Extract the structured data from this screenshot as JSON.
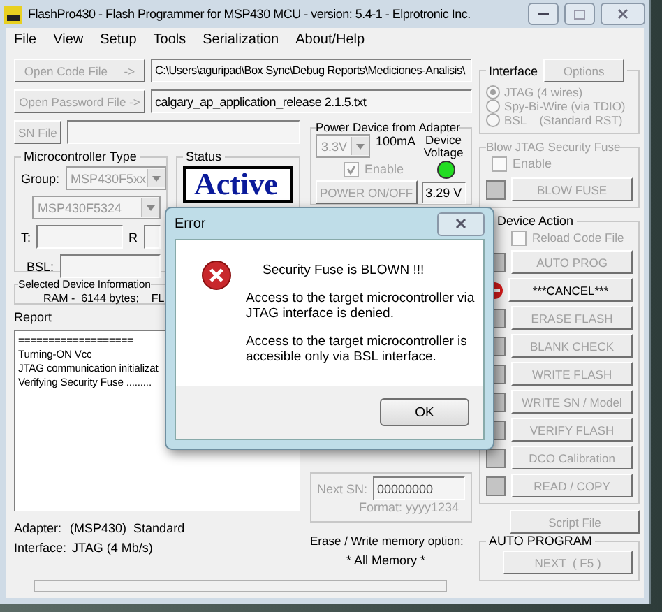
{
  "window": {
    "title": "FlashPro430 - Flash Programmer for MSP430 MCU - version: 5.4-1 - Elprotronic Inc."
  },
  "menu": [
    "File",
    "View",
    "Setup",
    "Tools",
    "Serialization",
    "About/Help"
  ],
  "files": [
    {
      "button": "Open Code File     ->",
      "value": "C:\\Users\\aguripad\\Box Sync\\Debug Reports\\Mediciones-Analisis\\",
      "disabled": true
    },
    {
      "button": "Open Password File ->",
      "value": "calgary_ap_application_release 2.1.5.txt",
      "disabled": true
    }
  ],
  "sn_file": {
    "button": "SN File",
    "disabled": true
  },
  "microcontroller": {
    "title": "Microcontroller Type",
    "group_label": "Group:",
    "group": "MSP430F5xx",
    "device": "MSP430F5324",
    "t_label": "T:",
    "r_label": "R",
    "bsl_label": "BSL:"
  },
  "status": {
    "title": "Status",
    "value": "Active"
  },
  "device_info": {
    "title": "Selected Device Information",
    "text": "RAM -  6144 bytes;    FL"
  },
  "report": {
    "title": "Report",
    "lines": [
      "===================",
      "Turning-ON Vcc",
      "JTAG communication initializat",
      "Verifying Security Fuse ........."
    ]
  },
  "adapter": {
    "label": "Adapter:",
    "value": "(MSP430)  Standard"
  },
  "interface_info": {
    "label": "Interface:",
    "value": "JTAG (4 Mb/s)"
  },
  "progress": {
    "level": 0
  },
  "power": {
    "title": "Power Device from Adapter",
    "voltage": "3.3V",
    "current": "100mA",
    "voltage_label": "Device Voltage",
    "enable": "Enable",
    "enable_checked": true,
    "on": true,
    "button": "POWER ON/OFF",
    "reading": "3.29 V"
  },
  "next_sn": {
    "label": "Next SN:",
    "value": "00000000",
    "format": "Format: yyyy1234"
  },
  "memory_option": {
    "label": "Erase / Write memory option:",
    "value": "* All Memory *"
  },
  "interface": {
    "title": "Interface",
    "options_button": "Options",
    "options": [
      {
        "label": "JTAG (4 wires)",
        "selected": true
      },
      {
        "label": "Spy-Bi-Wire (via TDIO)",
        "selected": false
      },
      {
        "label": "BSL    (Standard RST)",
        "selected": false
      }
    ]
  },
  "fuse": {
    "title": "Blow JTAG Security Fuse",
    "enable": "Enable",
    "enable_checked": false,
    "button": "BLOW FUSE"
  },
  "device_action": {
    "title": "Device Action",
    "reload": "Reload Code File",
    "reload_checked": false,
    "actions": [
      {
        "kind": "square",
        "label": "AUTO PROG",
        "disabled": true
      },
      {
        "kind": "stop",
        "label": "***CANCEL***",
        "disabled": false
      },
      {
        "kind": "square",
        "label": "ERASE FLASH",
        "disabled": true
      },
      {
        "kind": "square",
        "label": "BLANK CHECK",
        "disabled": true
      },
      {
        "kind": "square",
        "label": "WRITE FLASH",
        "disabled": true
      },
      {
        "kind": "square",
        "label": "WRITE SN / Model",
        "disabled": true
      },
      {
        "kind": "square",
        "label": "VERIFY FLASH",
        "disabled": true
      },
      {
        "kind": "square",
        "label": "DCO Calibration",
        "disabled": true
      },
      {
        "kind": "square",
        "label": "READ / COPY",
        "disabled": true
      }
    ]
  },
  "script_file": {
    "label": "Script File",
    "disabled": true
  },
  "auto_program": {
    "title": "AUTO PROGRAM",
    "button": "NEXT  ( F5 )",
    "disabled": true
  },
  "dialog": {
    "title": "Error",
    "heading": "Security Fuse is BLOWN !!!",
    "messages": [
      "Access to the target microcontroller via JTAG interface is denied.",
      "Access to the target microcontroller is accesible only via BSL interface."
    ],
    "button": "OK"
  }
}
